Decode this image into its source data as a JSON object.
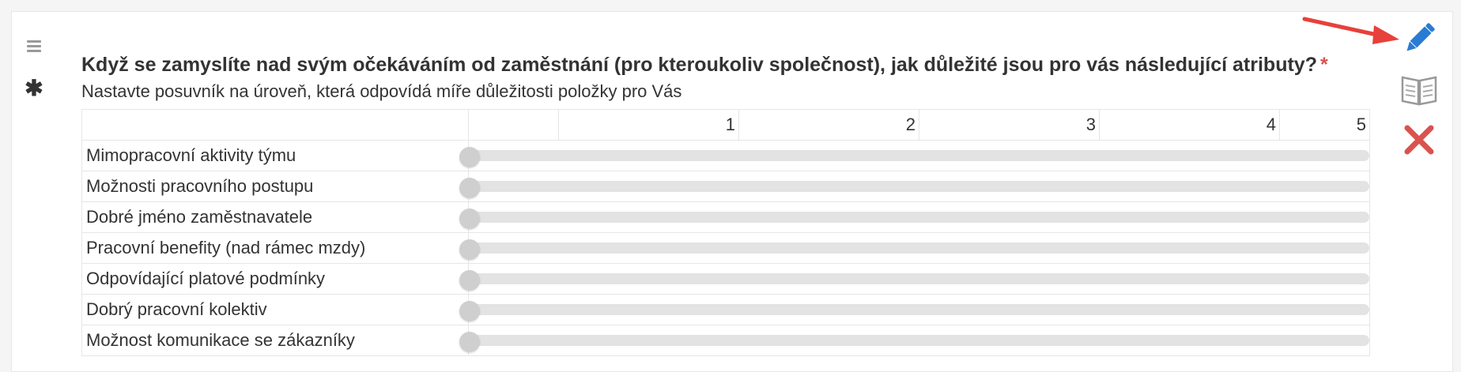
{
  "question": {
    "title": "Když se zamyslíte nad svým očekáváním od zaměstnání (pro kteroukoliv společnost), jak důležité jsou pro vás následující atributy?",
    "required_mark": "*",
    "help_text": "Nastavte posuvník na úroveň, která odpovídá míře důležitosti položky pro Vás"
  },
  "scale": {
    "columns": [
      "1",
      "2",
      "3",
      "4",
      "5"
    ]
  },
  "items": [
    {
      "label": "Mimopracovní aktivity týmu",
      "value": 0
    },
    {
      "label": "Možnosti pracovního postupu",
      "value": 0
    },
    {
      "label": "Dobré jméno zaměstnavatele",
      "value": 0
    },
    {
      "label": "Pracovní benefity (nad rámec mzdy)",
      "value": 0
    },
    {
      "label": "Odpovídající platové podmínky",
      "value": 0
    },
    {
      "label": "Dobrý pracovní kolektiv",
      "value": 0
    },
    {
      "label": "Možnost komunikace se zákazníky",
      "value": 0
    }
  ],
  "icons": {
    "left": [
      "hamburger-icon",
      "asterisk-icon"
    ],
    "right": [
      "pencil-icon",
      "book-icon",
      "close-icon"
    ],
    "annotation": "red-arrow-icon"
  },
  "colors": {
    "required": "#d9534f",
    "pencil": "#2a7bd4",
    "close": "#d9534f",
    "arrow": "#e8403a"
  }
}
